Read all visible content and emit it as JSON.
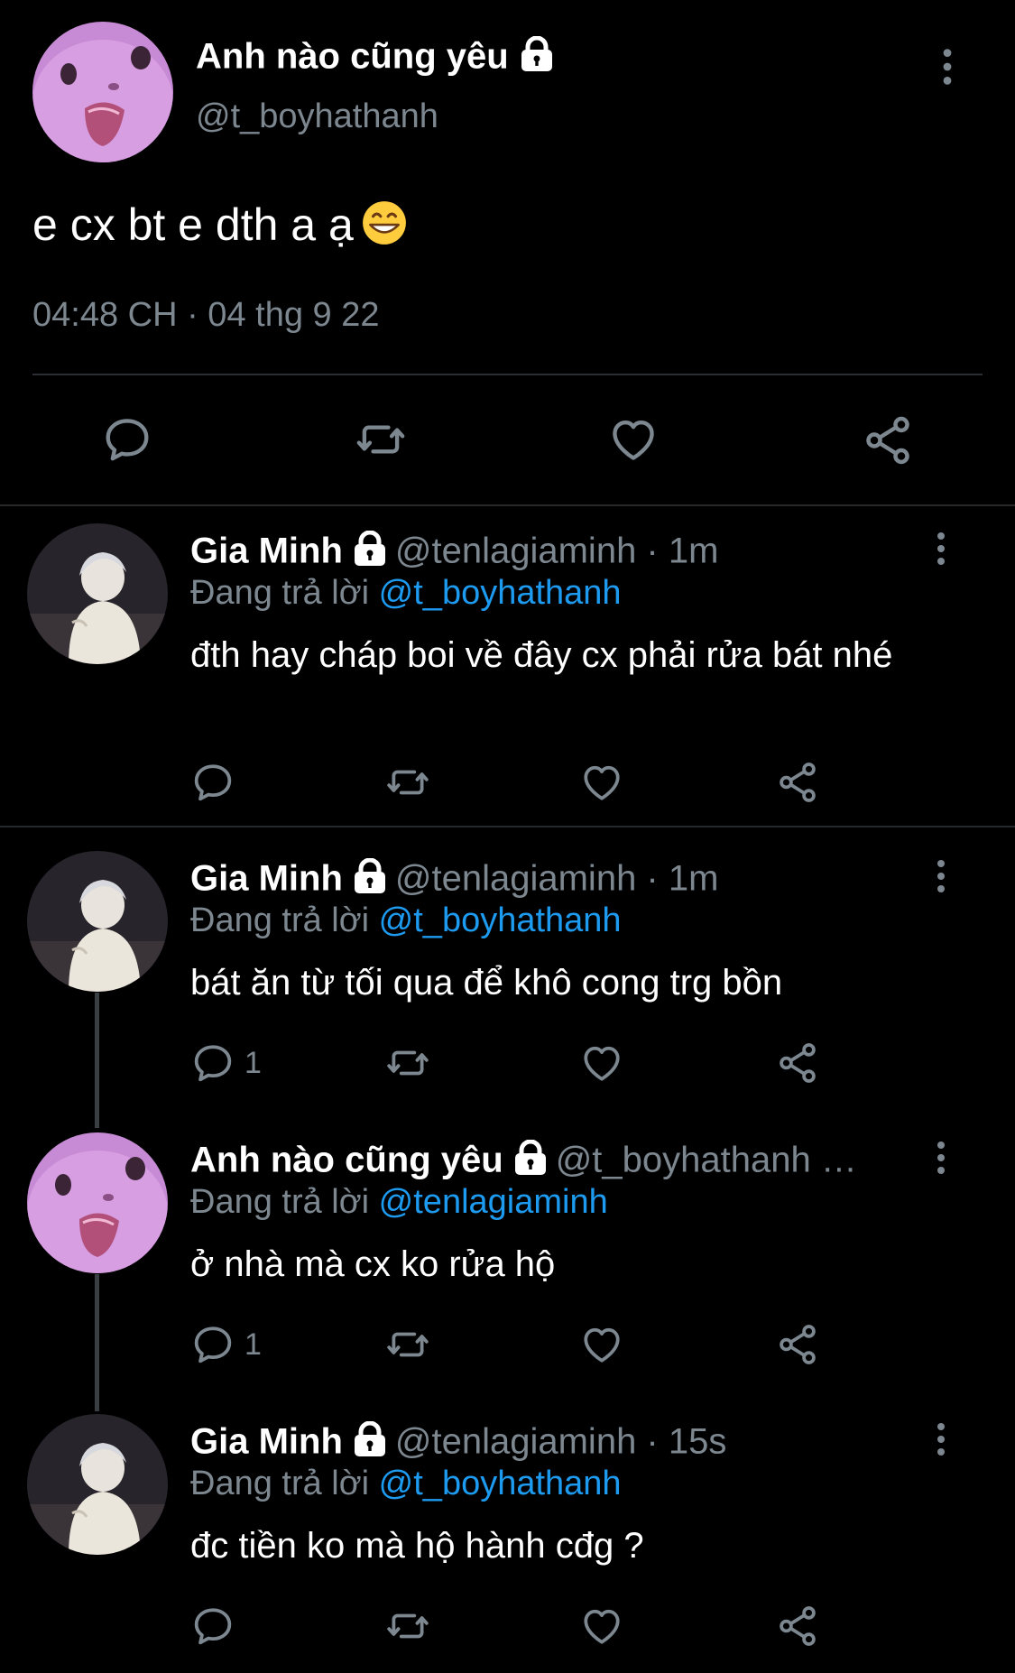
{
  "main": {
    "author_name": "Anh nào cũng yêu",
    "author_handle": "@t_boyhathanh",
    "text": "e cx bt e dth a ạ",
    "timestamp": "04:48 CH · 04 thg 9 22",
    "avatar_icon": "cat-avatar",
    "emoji_icon": "grinning-face-emoji"
  },
  "replies": [
    {
      "name": "Gia Minh",
      "handle": "@tenlagiaminh",
      "time": "1m",
      "replying_label": "Đang trả lời",
      "mention": "@t_boyhathanh",
      "text": "đth hay cháp boi về đây cx phải rửa bát nhé",
      "reply_count": ""
    },
    {
      "name": "Gia Minh",
      "handle": "@tenlagiaminh",
      "time": "1m",
      "replying_label": "Đang trả lời",
      "mention": "@t_boyhathanh",
      "text": "bát ăn từ tối qua để khô cong trg bồn",
      "reply_count": "1"
    },
    {
      "name": "Anh nào cũng yêu",
      "handle": "@t_boyhathanh …",
      "time": "",
      "replying_label": "Đang trả lời",
      "mention": "@tenlagiaminh",
      "text": "ở nhà mà cx ko rửa hộ",
      "reply_count": "1"
    },
    {
      "name": "Gia Minh",
      "handle": "@tenlagiaminh",
      "time": "15s",
      "replying_label": "Đang trả lời",
      "mention": "@t_boyhathanh",
      "text": "đc tiền ko mà hộ hành cđg ?",
      "reply_count": ""
    }
  ],
  "colors": {
    "background": "#000000",
    "muted": "#7d8790",
    "link": "#1d9bf0",
    "divider": "#26292c"
  }
}
